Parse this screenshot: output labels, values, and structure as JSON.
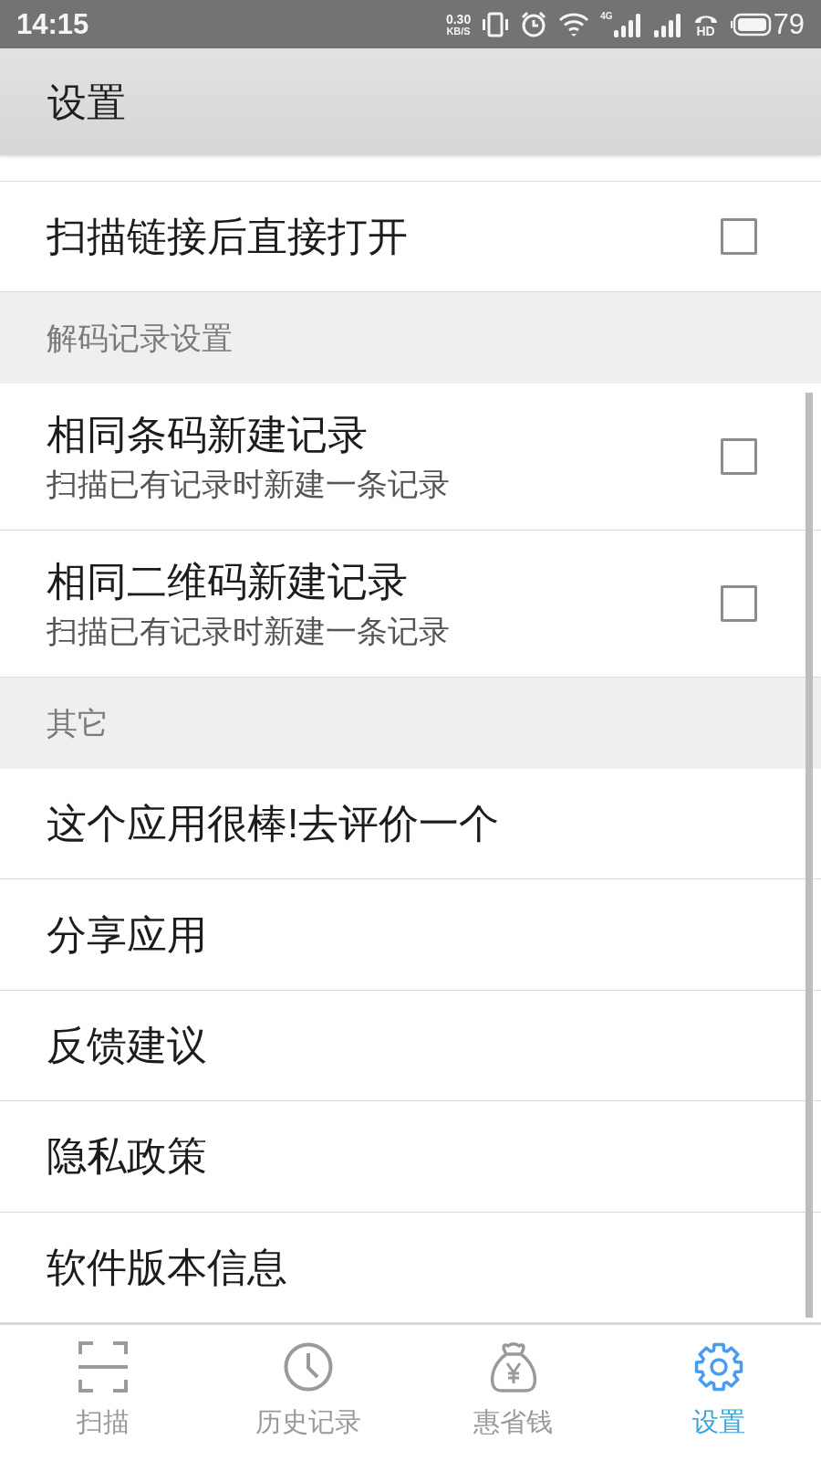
{
  "status_bar": {
    "time": "14:15",
    "speed_value": "0.30",
    "speed_unit": "KB/S",
    "network_type": "4G",
    "call_label": "HD",
    "battery": "79"
  },
  "header": {
    "title": "设置"
  },
  "settings": [
    {
      "kind": "checkbox",
      "title": "扫描链接后直接打开",
      "checked": false
    },
    {
      "kind": "section",
      "title": "解码记录设置"
    },
    {
      "kind": "checkbox",
      "title": "相同条码新建记录",
      "subtitle": "扫描已有记录时新建一条记录",
      "checked": false
    },
    {
      "kind": "checkbox",
      "title": "相同二维码新建记录",
      "subtitle": "扫描已有记录时新建一条记录",
      "checked": false
    },
    {
      "kind": "section",
      "title": "其它"
    },
    {
      "kind": "link",
      "title": "这个应用很棒!去评价一个"
    },
    {
      "kind": "link",
      "title": "分享应用"
    },
    {
      "kind": "link",
      "title": "反馈建议"
    },
    {
      "kind": "link",
      "title": "隐私政策"
    },
    {
      "kind": "link",
      "title": "软件版本信息"
    }
  ],
  "tabs": [
    {
      "label": "扫描",
      "selected": false
    },
    {
      "label": "历史记录",
      "selected": false
    },
    {
      "label": "惠省钱",
      "selected": false
    },
    {
      "label": "设置",
      "selected": true
    }
  ]
}
